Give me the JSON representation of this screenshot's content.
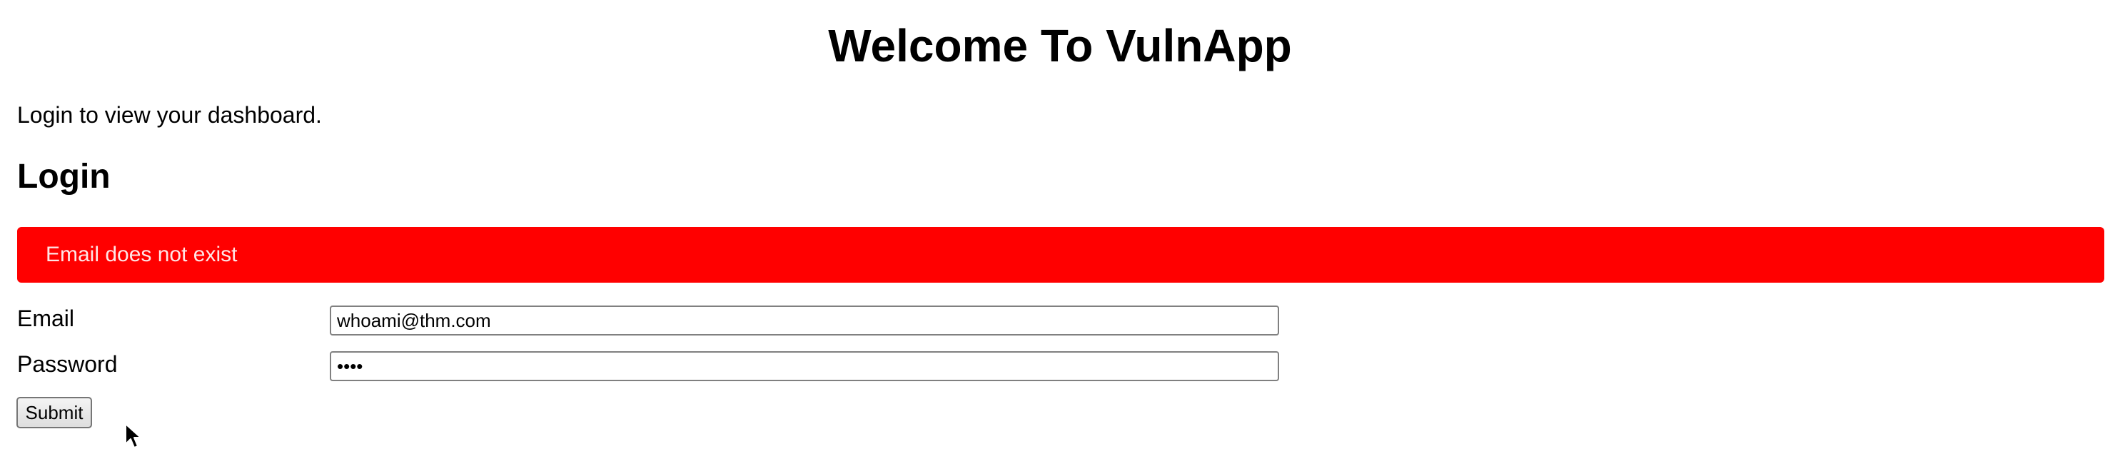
{
  "header": {
    "title": "Welcome To VulnApp"
  },
  "intro": {
    "text": "Login to view your dashboard."
  },
  "login": {
    "heading": "Login",
    "alert": {
      "message": "Email does not exist",
      "color": "#ff0000"
    },
    "email": {
      "label": "Email",
      "value": "whoami@thm.com"
    },
    "password": {
      "label": "Password",
      "value": "pass"
    },
    "submit_label": "Submit"
  },
  "cursor": {
    "icon": "mouse-pointer-icon"
  }
}
